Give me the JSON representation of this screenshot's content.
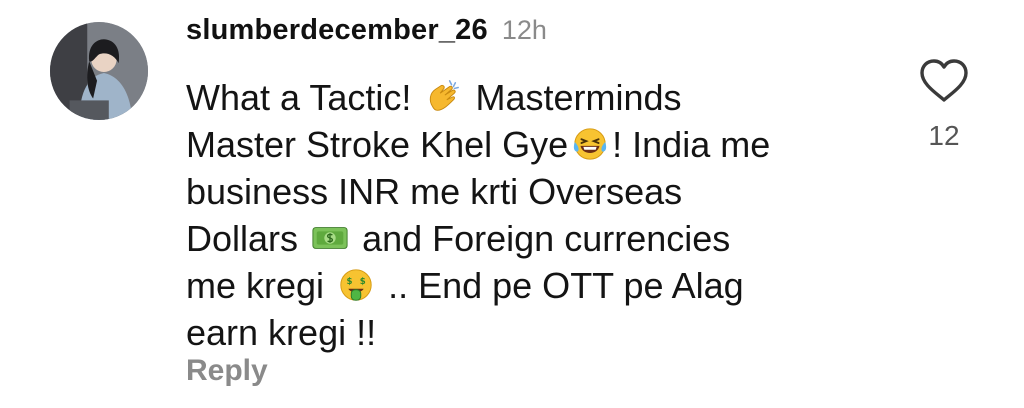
{
  "comment": {
    "avatar_icon": "profile-avatar",
    "username": "slumberdecember_26",
    "timestamp": "12h",
    "lines": [
      {
        "text_a": "What a Tactic!",
        "emoji": "clapping-hands-emoji",
        "text_b": "Masterminds"
      },
      {
        "text_a": "Master Stroke Khel Gye",
        "emoji": "laughing-tears-emoji",
        "text_b": "! India me"
      },
      {
        "text_a": "business INR me krti Overseas"
      },
      {
        "text_a": "Dollars",
        "emoji": "dollar-banknote-emoji",
        "text_b": "and Foreign currencies"
      },
      {
        "text_a": "me kregi",
        "emoji": "money-mouth-emoji",
        "text_b": ".. End pe OTT pe Alag"
      },
      {
        "text_a": "earn kregi !!"
      }
    ],
    "reply_label": "Reply",
    "like_icon": "heart-outline-icon",
    "like_count": "12"
  },
  "colors": {
    "text_primary": "#141414",
    "text_muted": "#8a8a8a",
    "like_count": "#555555",
    "background": "#ffffff"
  }
}
